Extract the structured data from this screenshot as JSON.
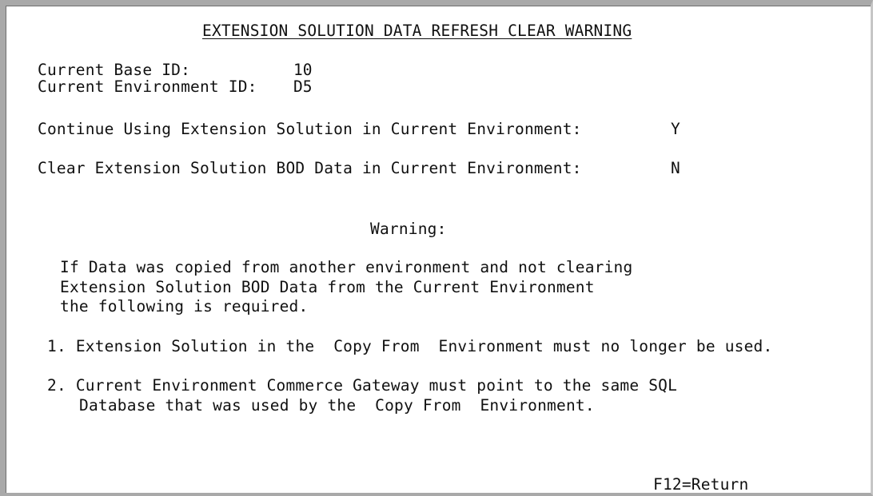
{
  "screen": {
    "title": "EXTENSION SOLUTION DATA REFRESH CLEAR WARNING"
  },
  "fields": {
    "base_id": {
      "label": "Current Base ID:",
      "value": "10"
    },
    "environment_id": {
      "label": "Current Environment ID:",
      "value": "D5"
    },
    "continue_using": {
      "label": "Continue Using Extension Solution in Current Environment:",
      "value": "Y"
    },
    "clear_bod": {
      "label": "Clear Extension Solution BOD Data in Current Environment:",
      "value": "N"
    }
  },
  "warning": {
    "heading": "Warning:",
    "lines": [
      "If Data was copied from another environment and not clearing",
      "Extension Solution BOD Data from the Current Environment",
      "the following is required."
    ],
    "item1": "1. Extension Solution in the  Copy From  Environment must no longer be used.",
    "item2_lines": [
      "2. Current Environment Commerce Gateway must point to the same SQL",
      "Database that was used by the  Copy From  Environment."
    ]
  },
  "function_keys": {
    "f12": "F12=Return"
  }
}
